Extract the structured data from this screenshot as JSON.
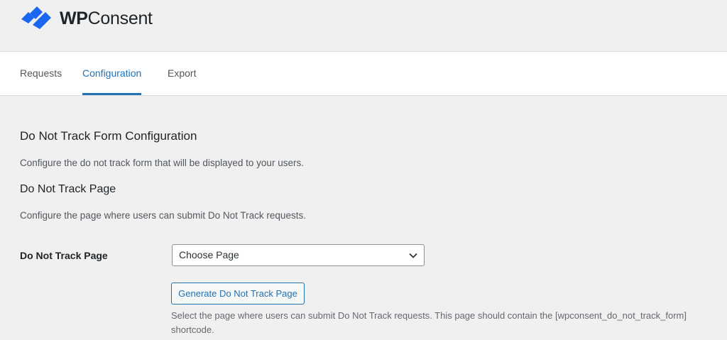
{
  "brand": {
    "name_bold": "WP",
    "name_rest": "Consent",
    "accent": "#1a66f0"
  },
  "tabs": [
    {
      "label": "Requests",
      "active": false
    },
    {
      "label": "Configuration",
      "active": true
    },
    {
      "label": "Export",
      "active": false
    }
  ],
  "main": {
    "section_title": "Do Not Track Form Configuration",
    "section_desc": "Configure the do not track form that will be displayed to your users.",
    "subsection_title": "Do Not Track Page",
    "subsection_desc": "Configure the page where users can submit Do Not Track requests.",
    "field_label": "Do Not Track Page",
    "select_value": "Choose Page",
    "generate_button": "Generate Do Not Track Page",
    "help_text": "Select the page where users can submit Do Not Track requests. This page should contain the [wpconsent_do_not_track_form] shortcode."
  }
}
